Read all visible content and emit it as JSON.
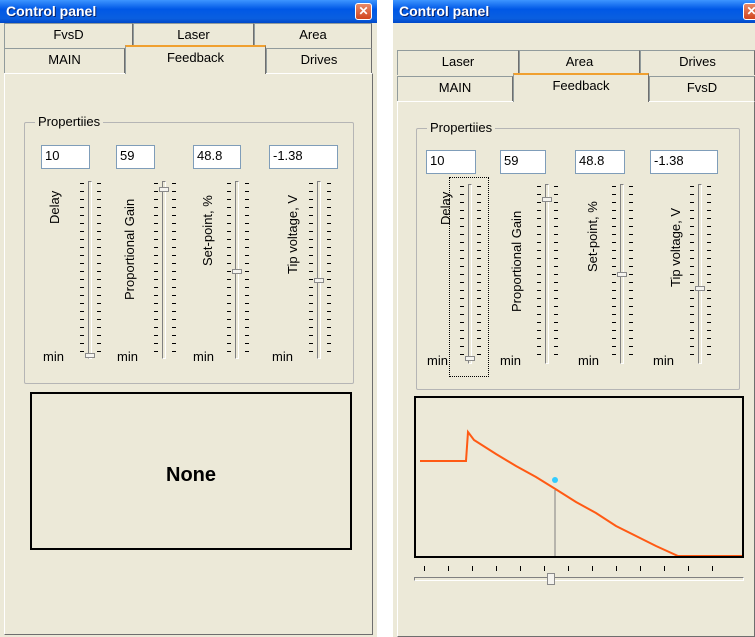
{
  "left_window": {
    "title": "Control panel",
    "tabs_row1": [
      "FvsD",
      "Laser",
      "Area"
    ],
    "tabs_row2": [
      "MAIN",
      "Feedback",
      "Drives"
    ],
    "active_tab": "Feedback",
    "group_title": "Propertiies",
    "fields": [
      {
        "label": "Delay",
        "value": "10",
        "slider_level": 0.0
      },
      {
        "label": "Proportional Gain",
        "value": "59",
        "slider_level": 0.95
      },
      {
        "label": "Set-point, %",
        "value": "48.8",
        "slider_level": 0.5
      },
      {
        "label": "Tip voltage, V",
        "value": "-1.38",
        "slider_level": 0.4
      }
    ],
    "min_label": "min",
    "display_text": "None"
  },
  "right_window": {
    "title": "Control panel",
    "tabs_row1": [
      "Laser",
      "Area",
      "Drives"
    ],
    "tabs_row2": [
      "MAIN",
      "Feedback",
      "FvsD"
    ],
    "active_tab": "Feedback",
    "group_title": "Propertiies",
    "fields": [
      {
        "label": "Delay",
        "value": "10",
        "slider_level": 0.0
      },
      {
        "label": "Proportional Gain",
        "value": "59",
        "slider_level": 0.95
      },
      {
        "label": "Set-point, %",
        "value": "48.8",
        "slider_level": 0.5
      },
      {
        "label": "Tip voltage, V",
        "value": "-1.38",
        "slider_level": 0.4
      }
    ],
    "min_label": "min",
    "graph_slider_level": 0.42
  },
  "colors": {
    "title_bar": "#0058e6",
    "face": "#ece9d8",
    "curve": "#ff5a14",
    "marker": "#33ccff",
    "close": "#d2451e"
  }
}
